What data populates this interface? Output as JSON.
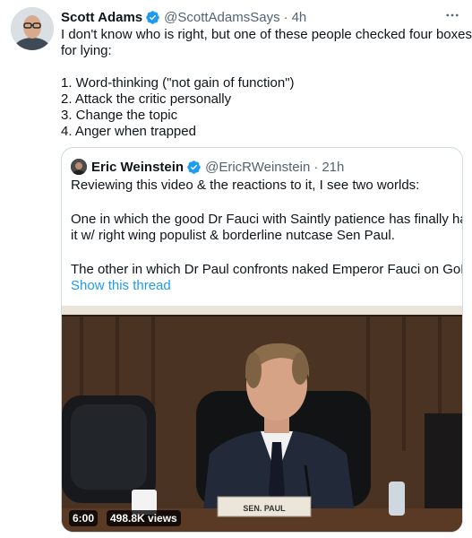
{
  "tweet": {
    "author_name": "Scott Adams",
    "handle": "@ScottAdamsSays",
    "time": "4h",
    "more_icon": "more-icon",
    "lines": [
      "I don't know who is right, but one of these people checked four boxes",
      "for lying:",
      "",
      "1. Word-thinking (\"not gain of function\")",
      "2. Attack the critic personally",
      "3. Change the topic",
      "4. Anger when trapped"
    ]
  },
  "quoted": {
    "author_name": "Eric Weinstein",
    "handle": "@EricRWeinstein",
    "time": "21h",
    "line1": "Reviewing this video & the reactions to it, I see two worlds:",
    "line2": "One in which the good Dr Fauci with Saintly patience has finally had",
    "line3": "it w/ right wing populist & borderline nutcase Sen Paul.",
    "line4": "The other in which Dr Paul confronts naked Emperor Fauci on GoFR.",
    "show_thread": "Show this thread",
    "video": {
      "duration": "6:00",
      "views": "498.8K views",
      "nameplate": "SEN. PAUL"
    }
  },
  "colors": {
    "link": "#1d9bf0",
    "verified": "#1d9bf0",
    "secondary_text": "#536471",
    "border": "#cfd9de"
  }
}
